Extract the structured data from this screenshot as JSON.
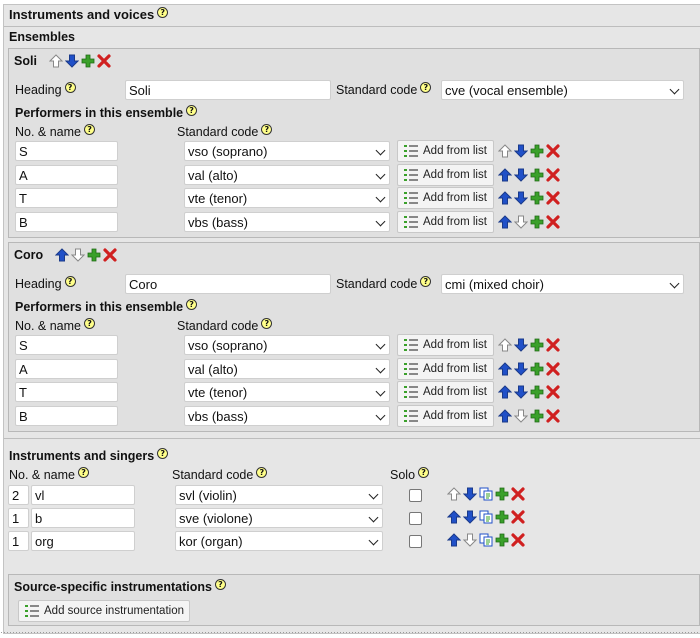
{
  "page": {
    "title": "Instruments and voices",
    "ensembles_title": "Ensembles",
    "colors": {
      "background": "#e6e6e6",
      "panel": "#e0e0e0",
      "arrow": "#2050c8",
      "add": "#3aa02a",
      "delete": "#d02020"
    }
  },
  "ensembles": [
    {
      "name": "Soli",
      "heading_label": "Heading",
      "heading_value": "Soli",
      "standard_code_label": "Standard code",
      "standard_code_value": "cve (vocal ensemble)",
      "performers_title": "Performers in this ensemble",
      "col_name": "No. & name",
      "col_code": "Standard code",
      "performers": [
        {
          "name": "S",
          "code": "vso (soprano)",
          "button": "Add from list"
        },
        {
          "name": "A",
          "code": "val (alto)",
          "button": "Add from list"
        },
        {
          "name": "T",
          "code": "vte (tenor)",
          "button": "Add from list"
        },
        {
          "name": "B",
          "code": "vbs (bass)",
          "button": "Add from list"
        }
      ]
    },
    {
      "name": "Coro",
      "heading_label": "Heading",
      "heading_value": "Coro",
      "standard_code_label": "Standard code",
      "standard_code_value": "cmi (mixed choir)",
      "performers_title": "Performers in this ensemble",
      "col_name": "No. & name",
      "col_code": "Standard code",
      "performers": [
        {
          "name": "S",
          "code": "vso (soprano)",
          "button": "Add from list"
        },
        {
          "name": "A",
          "code": "val (alto)",
          "button": "Add from list"
        },
        {
          "name": "T",
          "code": "vte (tenor)",
          "button": "Add from list"
        },
        {
          "name": "B",
          "code": "vbs (bass)",
          "button": "Add from list"
        }
      ]
    }
  ],
  "instruments": {
    "title": "Instruments and singers",
    "col_name": "No. & name",
    "col_code": "Standard code",
    "col_solo": "Solo",
    "rows": [
      {
        "count": "2",
        "name": "vl",
        "code": "svl (violin)"
      },
      {
        "count": "1",
        "name": "b",
        "code": "sve (violone)"
      },
      {
        "count": "1",
        "name": "org",
        "code": "kor (organ)"
      }
    ]
  },
  "source": {
    "title": "Source-specific instrumentations",
    "button": "Add source instrumentation"
  },
  "help_glyph": "?"
}
